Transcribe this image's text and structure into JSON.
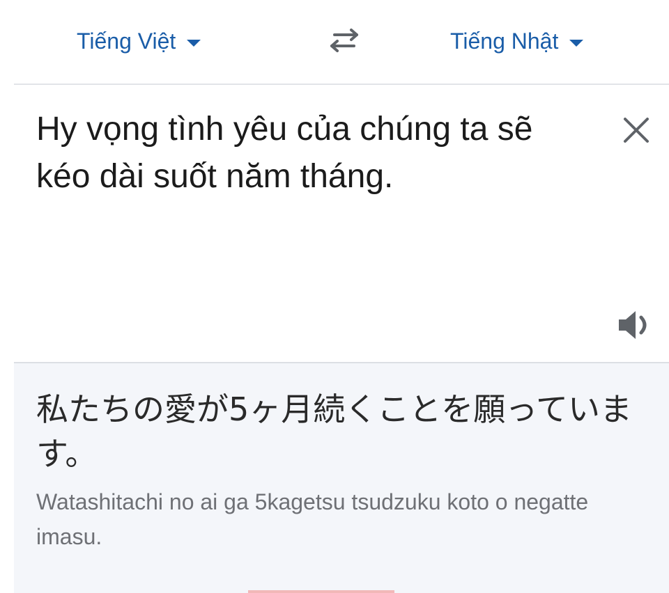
{
  "lang_bar": {
    "source_language": "Tiếng Việt",
    "target_language": "Tiếng Nhật"
  },
  "input": {
    "text": "Hy vọng tình yêu của chúng ta sẽ kéo dài suốt năm tháng."
  },
  "output": {
    "translation": "私たちの愛が5ヶ月続くことを願っています。",
    "romanization": "Watashitachi no ai ga 5kagetsu tsudzuku koto o negatte imasu."
  },
  "icons": {
    "swap": "swap-arrows-icon",
    "clear": "close-icon",
    "speaker": "speaker-icon",
    "dropdown": "caret-down-icon"
  },
  "colors": {
    "accent": "#1a5da8",
    "output_bg": "#f4f6fa",
    "romanization_text": "#6e7075"
  }
}
